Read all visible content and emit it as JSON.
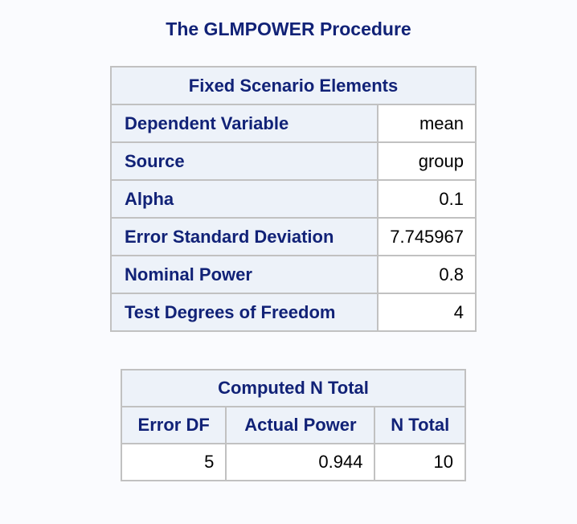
{
  "procedure_title": "The GLMPOWER Procedure",
  "fixed_table": {
    "caption": "Fixed Scenario Elements",
    "rows": [
      {
        "label": "Dependent Variable",
        "value": "mean"
      },
      {
        "label": "Source",
        "value": "group"
      },
      {
        "label": "Alpha",
        "value": "0.1"
      },
      {
        "label": "Error Standard Deviation",
        "value": "7.745967"
      },
      {
        "label": "Nominal Power",
        "value": "0.8"
      },
      {
        "label": "Test Degrees of Freedom",
        "value": "4"
      }
    ]
  },
  "computed_table": {
    "caption": "Computed N Total",
    "columns": [
      "Error DF",
      "Actual Power",
      "N Total"
    ],
    "rows": [
      [
        "5",
        "0.944",
        "10"
      ]
    ]
  }
}
